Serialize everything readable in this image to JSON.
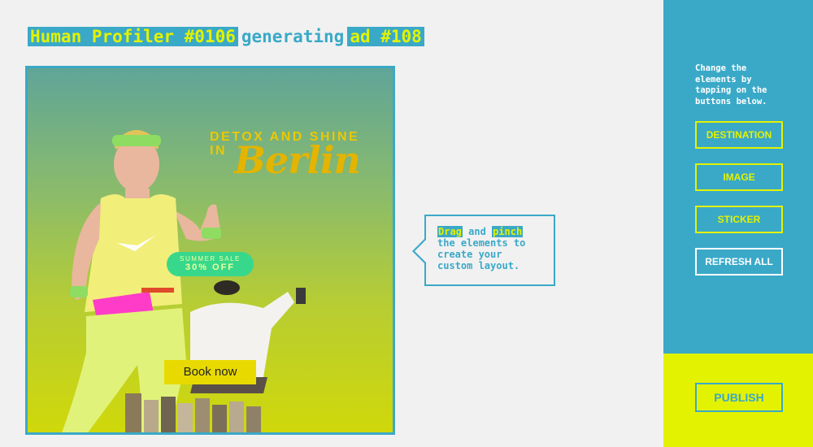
{
  "header": {
    "profiler_label": "Human Profiler #0106",
    "generating_text": "generating",
    "ad_label": "ad #108"
  },
  "ad": {
    "headline_line1": "DETOX AND SHINE",
    "headline_line2": "IN",
    "city": "Berlin",
    "sale_line1": "SUMMER SALE",
    "sale_line2": "30% OFF",
    "cta": "Book now"
  },
  "tooltip": {
    "word1": "Drag",
    "and": "and",
    "word2": "pinch",
    "line2": "the elements to",
    "line3": "create your",
    "line4": "custom layout."
  },
  "sidebar": {
    "instructions": "Change the elements by tapping on the buttons below.",
    "buttons": {
      "destination": "DESTINATION",
      "image": "IMAGE",
      "sticker": "STICKER",
      "refresh": "REFRESH ALL"
    },
    "publish": "PUBLISH"
  },
  "colors": {
    "accent_blue": "#3aa9c8",
    "accent_yellow": "#e3f200",
    "background": "#f1f1f1"
  }
}
